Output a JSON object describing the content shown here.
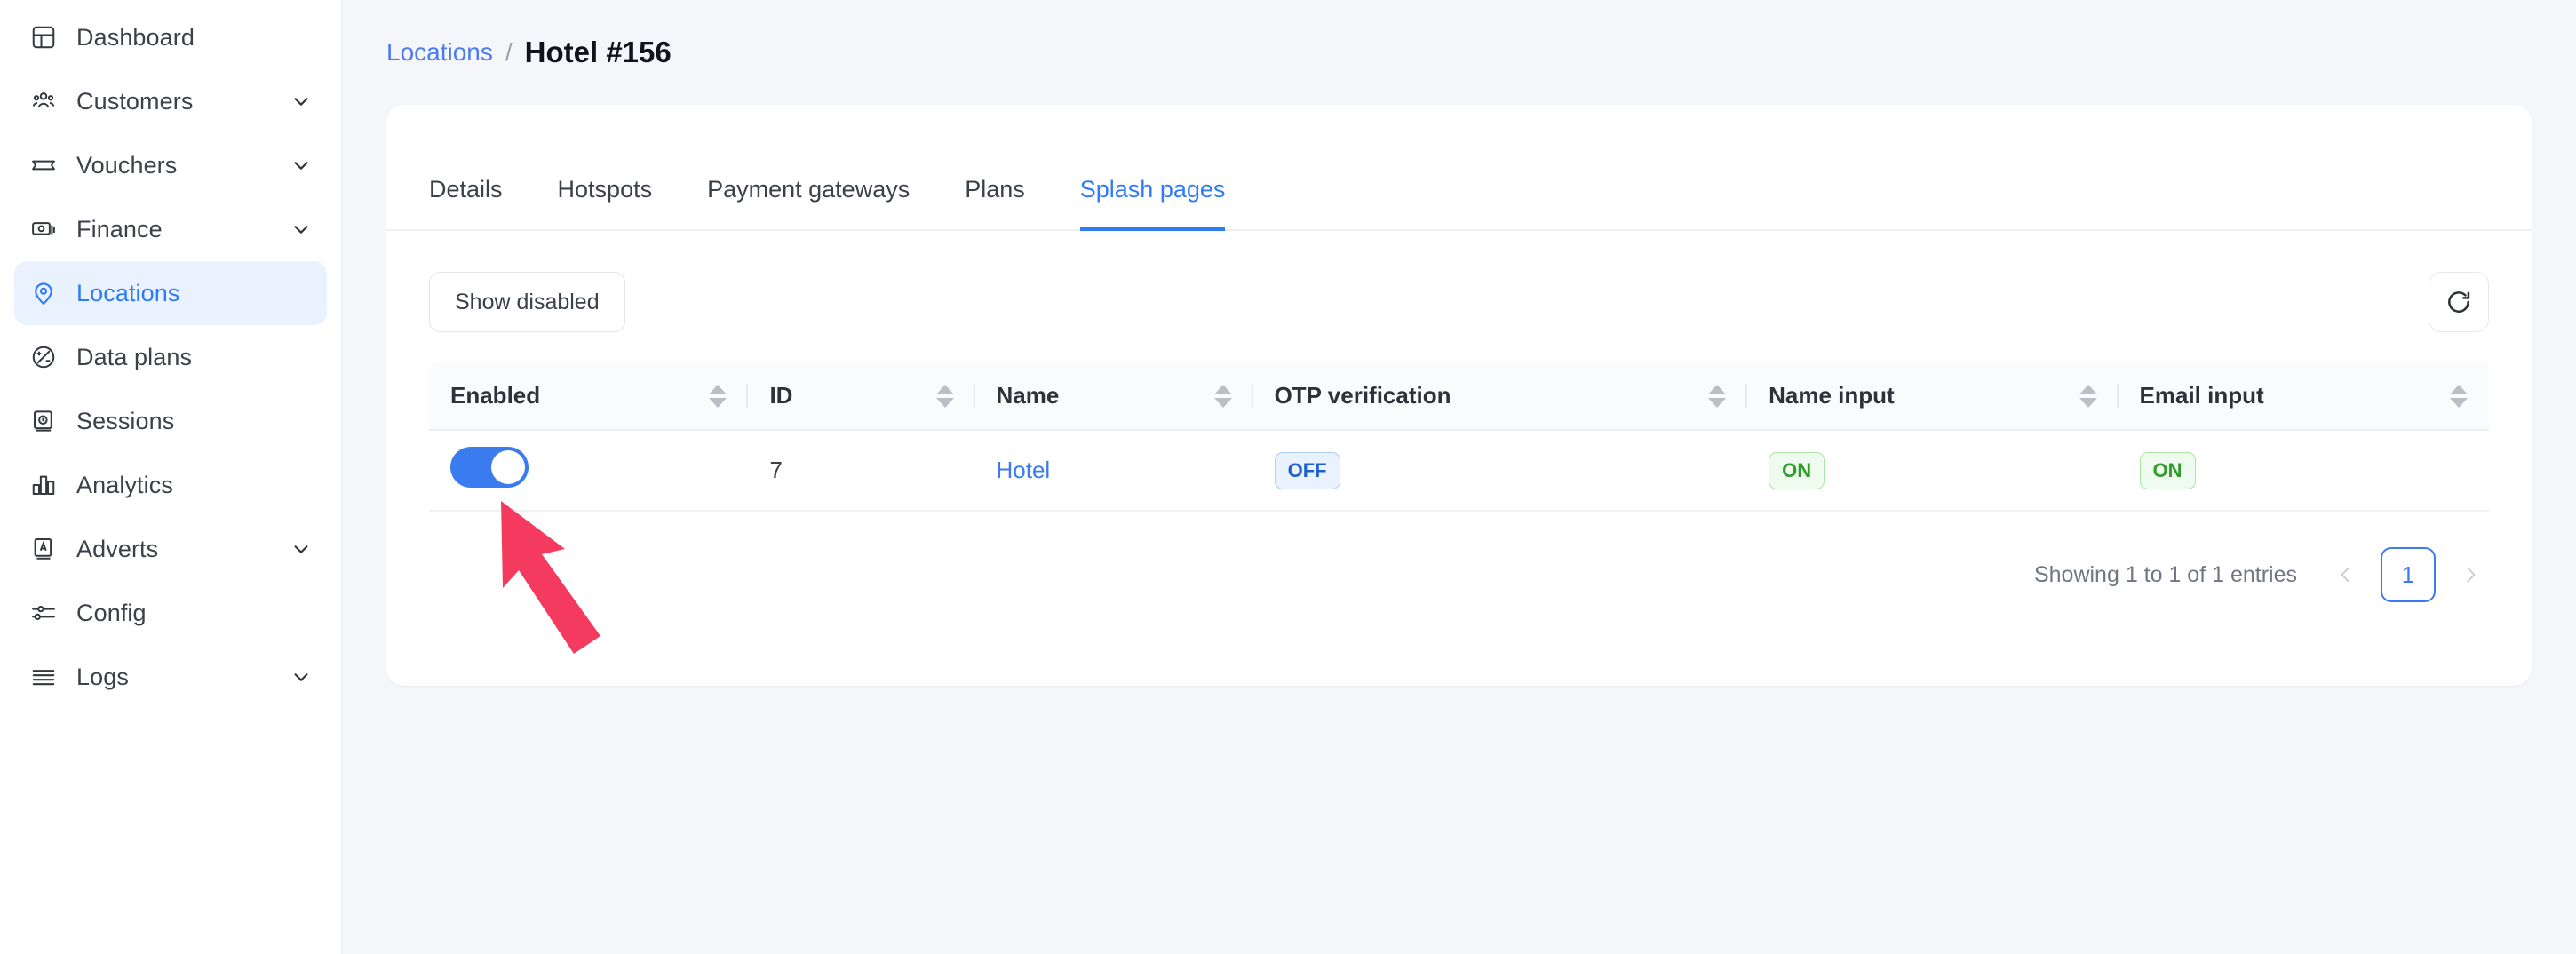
{
  "sidebar": {
    "items": [
      {
        "label": "Dashboard",
        "icon": "dashboard-icon",
        "active": false,
        "expandable": false
      },
      {
        "label": "Customers",
        "icon": "users-icon",
        "active": false,
        "expandable": true
      },
      {
        "label": "Vouchers",
        "icon": "ticket-icon",
        "active": false,
        "expandable": true
      },
      {
        "label": "Finance",
        "icon": "money-icon",
        "active": false,
        "expandable": true
      },
      {
        "label": "Locations",
        "icon": "map-pin-icon",
        "active": true,
        "expandable": false
      },
      {
        "label": "Data plans",
        "icon": "data-plan-icon",
        "active": false,
        "expandable": false
      },
      {
        "label": "Sessions",
        "icon": "sessions-icon",
        "active": false,
        "expandable": false
      },
      {
        "label": "Analytics",
        "icon": "bar-chart-icon",
        "active": false,
        "expandable": false
      },
      {
        "label": "Adverts",
        "icon": "advert-icon",
        "active": false,
        "expandable": true
      },
      {
        "label": "Config",
        "icon": "sliders-icon",
        "active": false,
        "expandable": false
      },
      {
        "label": "Logs",
        "icon": "list-icon",
        "active": false,
        "expandable": true
      }
    ],
    "active_color": "#2f7bf6",
    "active_background": "#eaf2ff"
  },
  "breadcrumb": {
    "parent": "Locations",
    "separator": "/",
    "current": "Hotel #156"
  },
  "tabs": [
    {
      "label": "Details",
      "active": false
    },
    {
      "label": "Hotspots",
      "active": false
    },
    {
      "label": "Payment gateways",
      "active": false
    },
    {
      "label": "Plans",
      "active": false
    },
    {
      "label": "Splash pages",
      "active": true
    }
  ],
  "toolbar": {
    "show_disabled_label": "Show disabled",
    "refresh_icon": "refresh-icon"
  },
  "table": {
    "columns": [
      {
        "label": "Enabled",
        "sortable": true
      },
      {
        "label": "ID",
        "sortable": true
      },
      {
        "label": "Name",
        "sortable": true
      },
      {
        "label": "OTP verification",
        "sortable": true
      },
      {
        "label": "Name input",
        "sortable": true
      },
      {
        "label": "Email input",
        "sortable": true
      }
    ],
    "rows": [
      {
        "enabled": true,
        "id": "7",
        "name": "Hotel",
        "otp_verification": "OFF",
        "name_input": "ON",
        "email_input": "ON"
      }
    ]
  },
  "footer": {
    "showing": "Showing 1 to 1 of 1 entries",
    "prev_label": "‹",
    "next_label": "›",
    "pages": [
      "1"
    ],
    "current_page": "1"
  },
  "annotation": {
    "type": "arrow",
    "color": "#f43a5e",
    "points_to": "enabled-toggle"
  }
}
